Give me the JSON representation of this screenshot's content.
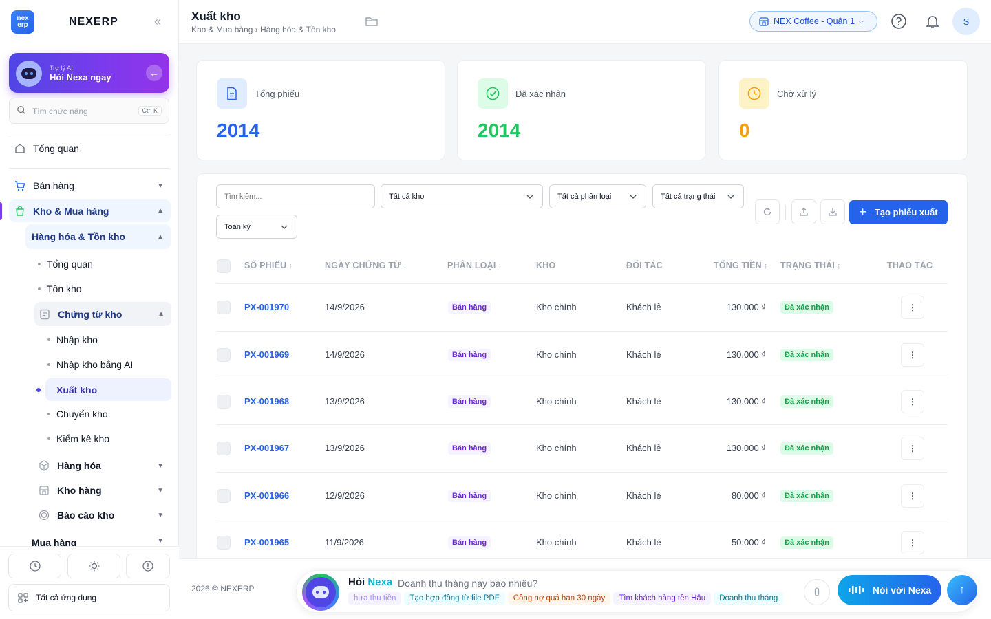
{
  "sidebar": {
    "brand": "NEXERP",
    "logo_top": "nex",
    "logo_bottom": "erp",
    "collapse_glyph": "«",
    "ai": {
      "small": "Trợ lý AI",
      "big": "Hỏi Nexa ngay"
    },
    "search": {
      "placeholder": "Tìm chức năng",
      "shortcut": "Ctrl K"
    },
    "overview": "Tổng quan",
    "sales": "Bán hàng",
    "warehouse_purchase": "Kho & Mua hàng",
    "goods_inventory": "Hàng hóa & Tồn kho",
    "sub_overview": "Tổng quan",
    "sub_stock": "Tồn kho",
    "vouchers": "Chứng từ kho",
    "voucher_items": [
      "Nhập kho",
      "Nhập kho bằng AI",
      "Xuất kho",
      "Chuyển kho",
      "Kiểm kê kho"
    ],
    "goods": "Hàng hóa",
    "warehouses": "Kho hàng",
    "reports": "Báo cáo kho",
    "purchase": "Mua hàng",
    "all_apps": "Tất cả ứng dụng"
  },
  "header": {
    "title": "Xuất kho",
    "breadcrumb": "Kho & Mua hàng › Hàng hóa & Tồn kho",
    "store": "NEX Coffee - Quận 1",
    "avatar": "S"
  },
  "stats": [
    {
      "label": "Tổng phiếu",
      "value": "2014",
      "color": "#2563eb"
    },
    {
      "label": "Đã xác nhận",
      "value": "2014",
      "color": "#22c55e"
    },
    {
      "label": "Chờ xử lý",
      "value": "0",
      "color": "#f59e0b"
    }
  ],
  "filters": {
    "search_placeholder": "Tìm kiếm...",
    "warehouse": "Tất cả kho",
    "category": "Tất cả phân loại",
    "status": "Tất cả trạng thái",
    "period": "Toàn kỳ",
    "create": "Tạo phiếu xuất"
  },
  "table": {
    "headers": [
      "SỐ PHIẾU",
      "NGÀY CHỨNG TỪ",
      "PHÂN LOẠI",
      "KHO",
      "ĐỐI TÁC",
      "TỔNG TIỀN",
      "TRẠNG THÁI",
      "THAO TÁC"
    ],
    "rows": [
      [
        "PX-001970",
        "14/9/2026",
        "Bán hàng",
        "Kho chính",
        "Khách lẻ",
        "130.000 ₫",
        "Đã xác nhận"
      ],
      [
        "PX-001969",
        "14/9/2026",
        "Bán hàng",
        "Kho chính",
        "Khách lẻ",
        "130.000 ₫",
        "Đã xác nhận"
      ],
      [
        "PX-001968",
        "13/9/2026",
        "Bán hàng",
        "Kho chính",
        "Khách lẻ",
        "130.000 ₫",
        "Đã xác nhận"
      ],
      [
        "PX-001967",
        "13/9/2026",
        "Bán hàng",
        "Kho chính",
        "Khách lẻ",
        "130.000 ₫",
        "Đã xác nhận"
      ],
      [
        "PX-001966",
        "12/9/2026",
        "Bán hàng",
        "Kho chính",
        "Khách lẻ",
        "80.000 ₫",
        "Đã xác nhận"
      ],
      [
        "PX-001965",
        "11/9/2026",
        "Bán hàng",
        "Kho chính",
        "Khách lẻ",
        "50.000 ₫",
        "Đã xác nhận"
      ]
    ]
  },
  "footer": {
    "copyright": "2026 © NEXERP",
    "ask_prefix": "Hỏi",
    "ask_name": "Nexa",
    "question": "Doanh thu tháng này bao nhiêu?",
    "chips": [
      "hưa thu tiền",
      "Tạo hợp đồng từ file PDF",
      "Công nợ quá hạn 30 ngày",
      "Tìm khách hàng tên Hậu",
      "Doanh thu tháng"
    ],
    "talk": "Nói với Nexa"
  }
}
